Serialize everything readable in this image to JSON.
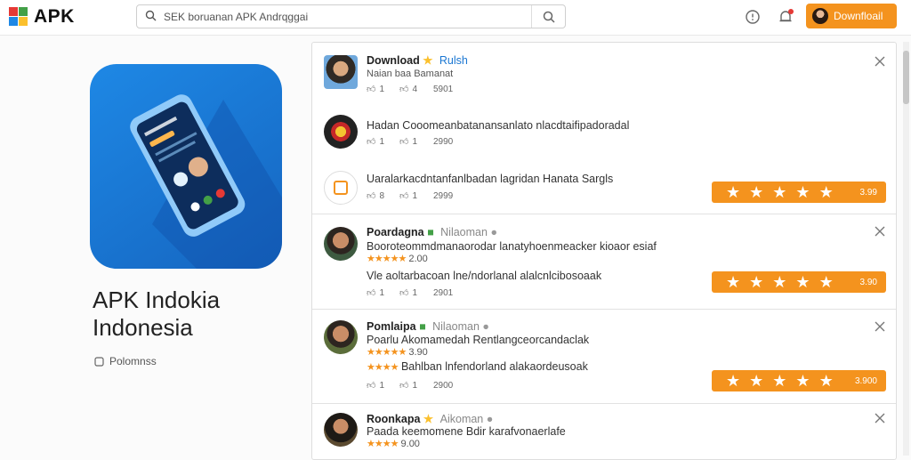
{
  "brand": {
    "name": "APK",
    "accent": "#f4931e"
  },
  "search": {
    "text": "SEK boruanan APK Andrqggai"
  },
  "header": {
    "download_label": "Downfloail"
  },
  "app": {
    "title_line1": "APK Indokia",
    "title_line2": "Indonesia",
    "meta": "Polomnss"
  },
  "feed": {
    "items": [
      {
        "name": "Download",
        "badge": "Rulsh",
        "line1": "Naian baa Bamanat",
        "actions": [
          "1",
          "4",
          "5901"
        ]
      },
      {
        "name": "",
        "badge": "",
        "line1": "Hadan Cooomeanbatanansanlato nlacdtaifipadoradal",
        "actions": [
          "1",
          "1",
          "2990"
        ]
      },
      {
        "name": "",
        "badge": "",
        "line1": "Uaralarkacdntanfanlbadan lagridan Hanata Sargls",
        "actions": [
          "8",
          "1",
          "2999"
        ],
        "rating_value": "3.99"
      },
      {
        "name": "Poardagna",
        "badge": "Nilaoman",
        "line1": "Booroteommdmanaorodar lanatyhoenmeacker kioaor esiaf",
        "rating": "2.00",
        "line2": "Vle aoltarbacoan lne/ndorlanal alalcnlcibosoaak",
        "actions": [
          "1",
          "1",
          "2901"
        ],
        "rating_value": "3.90"
      },
      {
        "name": "Pomlaipa",
        "badge": "Nilaoman",
        "line1": "Poarlu Akomamedah Rentlangceorcandaclak",
        "rating": "3.90",
        "line2": "Bahlban lnfendorland alakaordeusoak",
        "actions": [
          "1",
          "1",
          "2900"
        ],
        "rating_value": "3.900"
      },
      {
        "name": "Roonkapa",
        "badge": "Aikoman",
        "line1": "Paada keemomene Bdir karafvonaerlafe",
        "rating": "9.00",
        "actions": []
      }
    ]
  }
}
